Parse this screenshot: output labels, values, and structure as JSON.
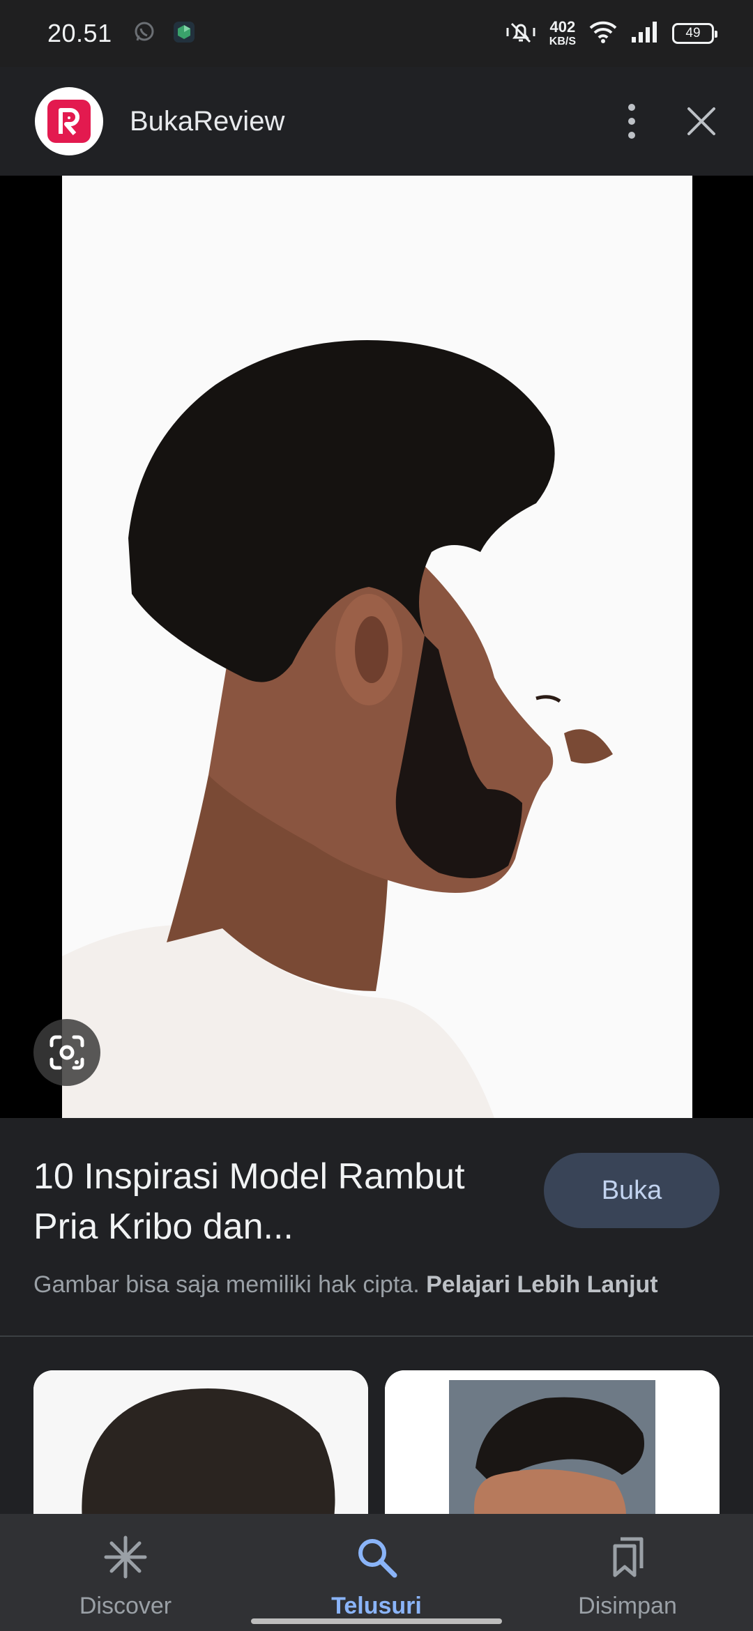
{
  "status_bar": {
    "time": "20.51",
    "net_speed_value": "402",
    "net_speed_unit": "KB/S",
    "battery_level": "49",
    "icons": [
      "whatsapp-icon",
      "app-cube-icon",
      "vibrate-off-icon",
      "wifi-icon",
      "signal-icon",
      "battery-icon"
    ]
  },
  "header": {
    "site_name": "BukaReview",
    "logo_color": "#e31a4f",
    "icons": [
      "more-vert-icon",
      "close-icon"
    ]
  },
  "image": {
    "lens_icon": "google-lens-icon"
  },
  "result": {
    "title": "10 Inspirasi Model Rambut Pria Kribo dan...",
    "open_button_label": "Buka",
    "copyright_text": "Gambar bisa saja memiliki hak cipta.",
    "learn_more_label": "Pelajari Lebih Lanjut"
  },
  "bottom_nav": {
    "items": [
      {
        "label": "Discover",
        "icon": "discover-asterisk-icon",
        "active": false
      },
      {
        "label": "Telusuri",
        "icon": "search-icon",
        "active": true
      },
      {
        "label": "Disimpan",
        "icon": "saved-collections-icon",
        "active": false
      }
    ],
    "active_color": "#8ab4f8"
  }
}
